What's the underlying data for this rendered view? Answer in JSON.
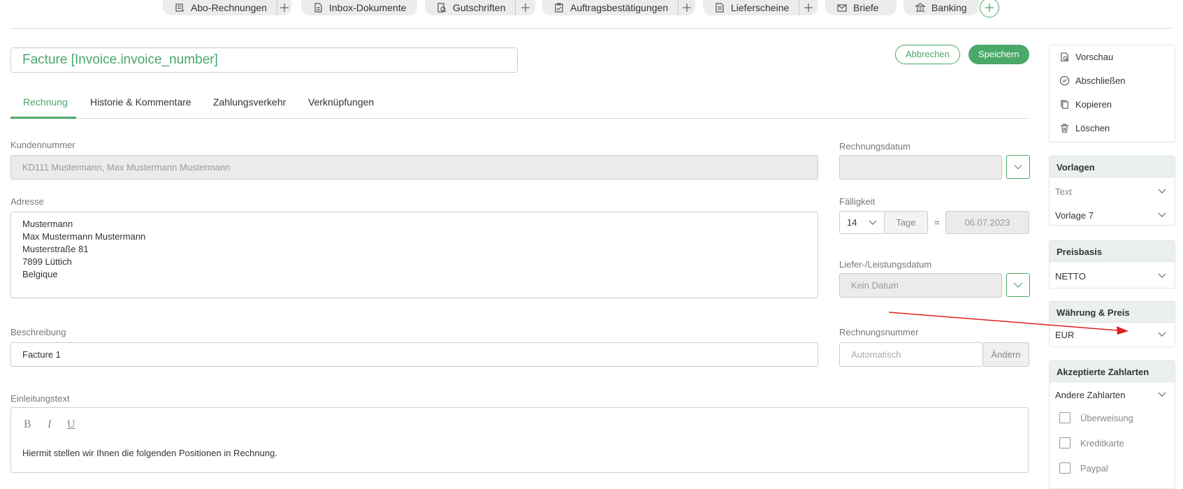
{
  "top_tabs": [
    {
      "label": "Abo-Rechnungen",
      "icon": "recurring-invoice-icon",
      "has_plus": true
    },
    {
      "label": "Inbox-Dokumente",
      "icon": "inbox-document-icon",
      "has_plus": false
    },
    {
      "label": "Gutschriften",
      "icon": "credit-note-icon",
      "has_plus": true
    },
    {
      "label": "Auftragsbestätigungen",
      "icon": "order-confirmation-icon",
      "has_plus": true
    },
    {
      "label": "Lieferscheine",
      "icon": "delivery-note-icon",
      "has_plus": true
    },
    {
      "label": "Briefe",
      "icon": "mail-icon",
      "has_plus": false
    },
    {
      "label": "Banking",
      "icon": "bank-icon",
      "has_plus": false
    }
  ],
  "header": {
    "title": "Facture [Invoice.invoice_number]",
    "cancel_label": "Abbrechen",
    "save_label": "Speichern"
  },
  "tabs": [
    "Rechnung",
    "Historie & Kommentare",
    "Zahlungsverkehr",
    "Verknüpfungen"
  ],
  "form": {
    "customer_label": "Kundennummer",
    "customer_value": "KD111 Mustermann, Max Mustermann Mustermann",
    "address_label": "Adresse",
    "address_lines": [
      "Mustermann",
      "Max Mustermann Mustermann",
      "Musterstraße 81",
      "7899 Lüttich",
      "Belgique"
    ],
    "description_label": "Beschreibung",
    "description_value": "Facture 1",
    "intro_label": "Einleitungstext",
    "intro_text": "Hiermit stellen wir Ihnen die folgenden Positionen in Rechnung.",
    "format_bold": "B",
    "format_italic": "I",
    "format_underline": "U",
    "invoice_date_label": "Rechnungsdatum",
    "due_label": "Fälligkeit",
    "due_days": "14",
    "due_unit": "Tage",
    "due_equals": "=",
    "due_date": "06.07.2023",
    "delivery_label": "Liefer-/Leistungsdatum",
    "delivery_placeholder": "Kein Datum",
    "invoice_number_label": "Rechnungsnummer",
    "invoice_number_placeholder": "Automatisch",
    "change_label": "Ändern"
  },
  "sidebar": {
    "actions": [
      {
        "label": "Vorschau",
        "icon": "preview-icon"
      },
      {
        "label": "Abschließen",
        "icon": "check-circle-icon"
      },
      {
        "label": "Kopieren",
        "icon": "copy-icon"
      },
      {
        "label": "Löschen",
        "icon": "trash-icon"
      }
    ],
    "templates_title": "Vorlagen",
    "template_text": "Text",
    "template_value": "Vorlage 7",
    "price_basis_title": "Preisbasis",
    "price_basis_value": "NETTO",
    "currency_title": "Währung & Preis",
    "currency_value": "EUR",
    "payment_title": "Akzeptierte Zahlarten",
    "payment_other": "Andere Zahlarten",
    "payment_methods": [
      "Überweisung",
      "Kreditkarte",
      "Paypal"
    ]
  },
  "colors": {
    "accent": "#4aa868",
    "annotation_arrow": "#e02020"
  }
}
